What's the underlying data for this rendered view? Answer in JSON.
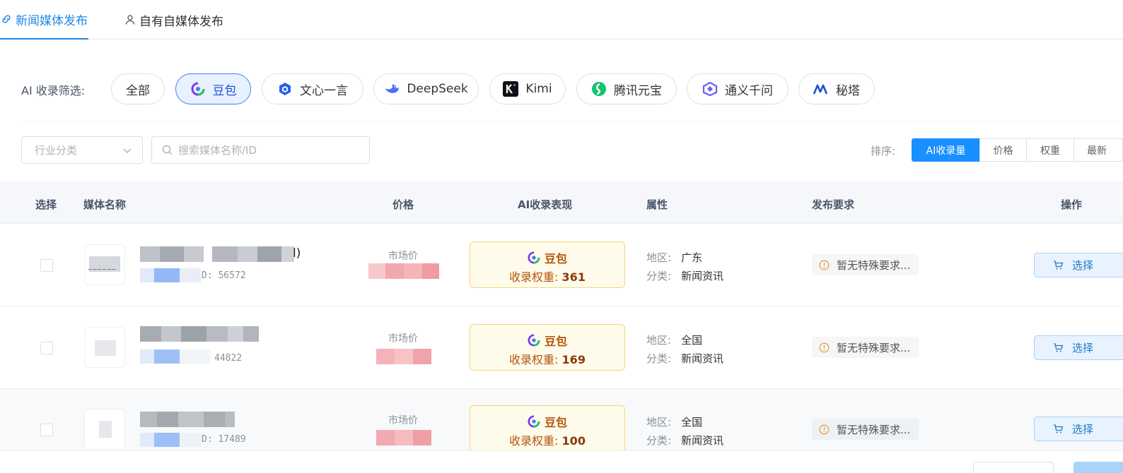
{
  "tabs": [
    {
      "label": "新闻媒体发布",
      "icon": "link-icon",
      "active": true
    },
    {
      "label": "自有自媒体发布",
      "icon": "user-icon",
      "active": false
    }
  ],
  "ai_filter": {
    "label": "AI 收录筛选:",
    "options": [
      {
        "label": "全部",
        "icon": "",
        "active": false
      },
      {
        "label": "豆包",
        "icon": "doubao-logo-icon",
        "active": true
      },
      {
        "label": "文心一言",
        "icon": "wenxin-logo-icon",
        "active": false
      },
      {
        "label": "DeepSeek",
        "icon": "deepseek-whale-icon",
        "active": false
      },
      {
        "label": "Kimi",
        "icon": "kimi-logo-icon",
        "active": false
      },
      {
        "label": "腾讯元宝",
        "icon": "yuanbao-logo-icon",
        "active": false
      },
      {
        "label": "通义千问",
        "icon": "tongyi-logo-icon",
        "active": false
      },
      {
        "label": "秘塔",
        "icon": "mita-logo-icon",
        "active": false
      }
    ]
  },
  "filters": {
    "industry_placeholder": "行业分类",
    "search_placeholder": "搜索媒体名称/ID"
  },
  "sort": {
    "label": "排序:",
    "options": [
      "AI收录量",
      "价格",
      "权重",
      "最新"
    ],
    "active": "AI收录量"
  },
  "table": {
    "headers": [
      "选择",
      "媒体名称",
      "价格",
      "AI收录表现",
      "属性",
      "发布要求",
      "操作"
    ],
    "rows": [
      {
        "name_suffix": "l)",
        "id_suffix": "D: 56572",
        "market_label": "市场价",
        "ai_name": "豆包",
        "weight_label": "收录权重:",
        "weight": "361",
        "region_label": "地区:",
        "region": "广东",
        "category_label": "分类:",
        "category": "新闻资讯",
        "requirement": "暂无特殊要求...",
        "action": "选择"
      },
      {
        "name_suffix": "",
        "id_suffix": "44822",
        "market_label": "市场价",
        "ai_name": "豆包",
        "weight_label": "收录权重:",
        "weight": "169",
        "region_label": "地区:",
        "region": "全国",
        "category_label": "分类:",
        "category": "新闻资讯",
        "requirement": "暂无特殊要求...",
        "action": "选择"
      },
      {
        "name_suffix": "",
        "id_suffix": "D: 17489",
        "market_label": "市场价",
        "ai_name": "豆包",
        "weight_label": "收录权重:",
        "weight": "100",
        "region_label": "地区:",
        "region": "全国",
        "category_label": "分类:",
        "category": "新闻资讯",
        "requirement": "暂无特殊要求...",
        "action": "选择"
      }
    ]
  },
  "colors": {
    "accent": "#1890ff",
    "ai_card_bg": "#fffbea",
    "ai_card_text": "#b45309",
    "warning": "#e6a23c"
  }
}
